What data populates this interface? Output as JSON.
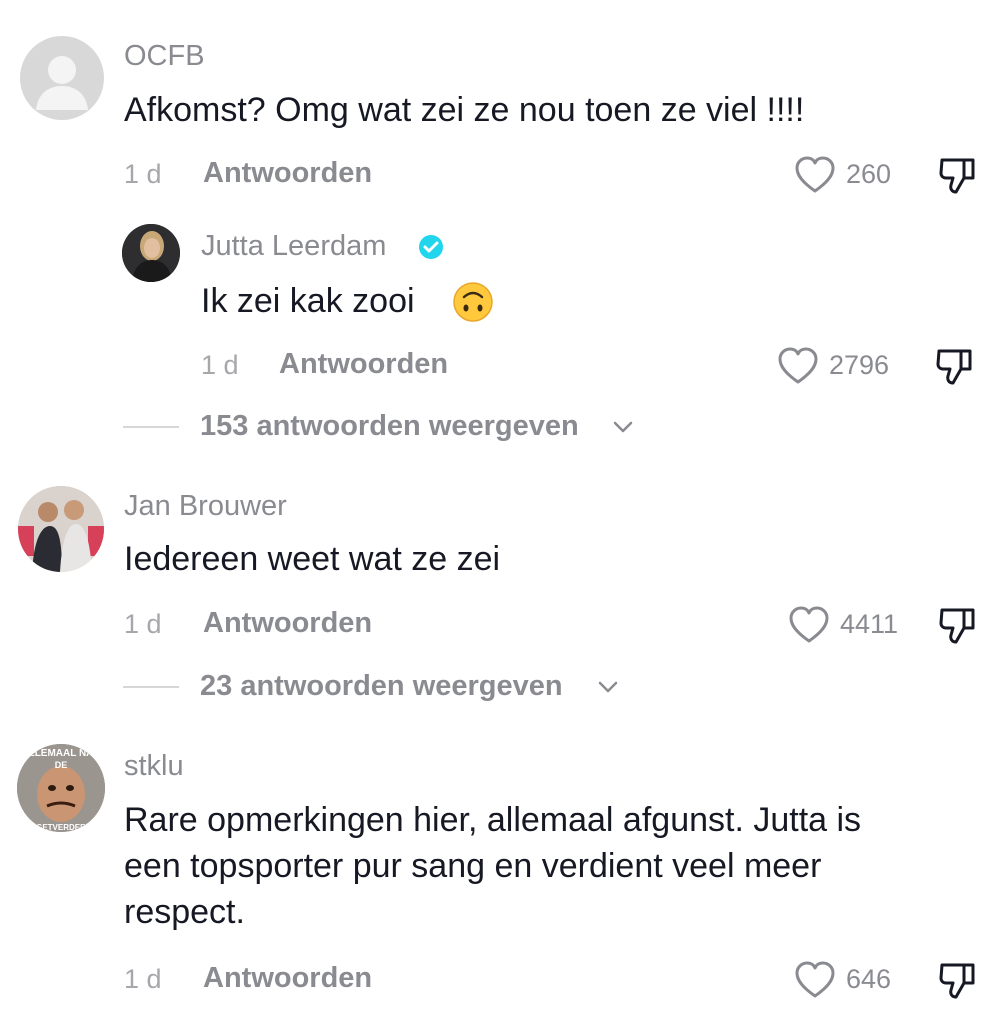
{
  "comments": [
    {
      "username": "OCFB",
      "text": "Afkomst? Omg wat zei ze nou toen ze viel !!!!",
      "time": "1 d",
      "reply_label": "Antwoorden",
      "likes": "260",
      "reply": {
        "username": "Jutta Leerdam",
        "text": "Ik zei kak zooi",
        "time": "1 d",
        "reply_label": "Antwoorden",
        "likes": "2796"
      },
      "view_replies": "153 antwoorden weergeven"
    },
    {
      "username": "Jan Brouwer",
      "text": "Iedereen weet wat ze zei",
      "time": "1 d",
      "reply_label": "Antwoorden",
      "likes": "4411",
      "view_replies": "23 antwoorden weergeven"
    },
    {
      "username": "stklu",
      "text_lines": [
        "Rare opmerkingen hier, allemaal afgunst. Jutta is",
        "een topsporter pur sang en verdient veel meer",
        "respect."
      ],
      "time": "1 d",
      "reply_label": "Antwoorden",
      "likes": "646"
    }
  ],
  "avatar_text": {
    "stklu_top": "LLEMAAL NA",
    "stklu_mid": "DE",
    "stklu_bottom": "GETVERDER"
  },
  "icons": {
    "like": "heart-outline-icon",
    "dislike": "thumbs-down-icon",
    "verified": "verified-badge-icon",
    "expand": "chevron-down-icon",
    "emoji": "upside-down-face-emoji"
  },
  "colors": {
    "username": "#8a8b91",
    "text": "#161823",
    "verified": "#20d5ec",
    "emoji": "#ffc83d"
  }
}
